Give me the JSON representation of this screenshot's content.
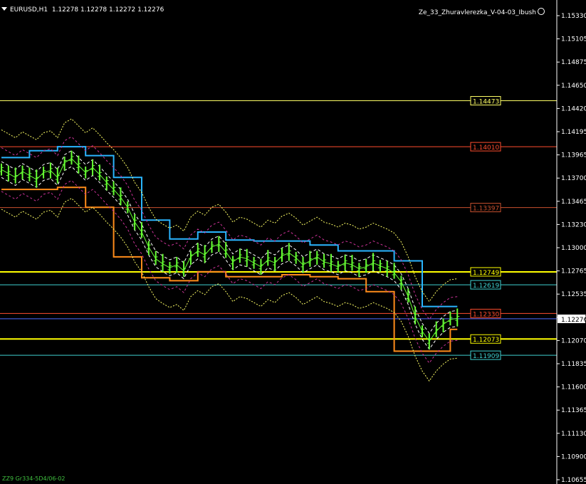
{
  "header": {
    "symbol": "EURUSD,H1",
    "ohlc": "1.12278 1.12278 1.12272 1.12276"
  },
  "indicator_name": "Ze_33_Zhuravlerezka_V-04-03_Ibush",
  "footer_text": "ZZ9 Gr334-5D4/06-02",
  "price_axis": {
    "min": 1.10655,
    "max": 1.1533,
    "ticks": [
      "1.15330",
      "1.15105",
      "1.14875",
      "1.14650",
      "1.14420",
      "1.14195",
      "1.13965",
      "1.13700",
      "1.13465",
      "1.13230",
      "1.13000",
      "1.12765",
      "1.12535",
      "1.12305",
      "1.12070",
      "1.11835",
      "1.11600",
      "1.11365",
      "1.11130",
      "1.10900",
      "1.10655"
    ]
  },
  "current_price": {
    "label": "1.12276",
    "value": 1.12276
  },
  "levels": [
    {
      "label": "1.14473",
      "value": 1.14473,
      "color": "#ffff66"
    },
    {
      "label": "1.14010",
      "value": 1.1401,
      "color": "#ff4d2e"
    },
    {
      "label": "1.13397",
      "value": 1.13397,
      "color": "#c8502e"
    },
    {
      "label": "1.12749",
      "value": 1.12749,
      "color": "#ffff00"
    },
    {
      "label": "1.12619",
      "value": 1.12619,
      "color": "#3fd0d0"
    },
    {
      "label": "1.12330",
      "value": 1.1233,
      "color": "#ff4d2e"
    },
    {
      "label": "1.12073",
      "value": 1.12073,
      "color": "#ffff00"
    },
    {
      "label": "1.11909",
      "value": 1.11909,
      "color": "#3fd0d0"
    }
  ],
  "colors": {
    "background": "#000000",
    "candle": "#66ff33",
    "channel_blue": "#2ab5ff",
    "channel_orange": "#ff8c1a",
    "band_yellow": "#ffff66",
    "band_magenta": "#cc3399",
    "band_white": "#ffffff"
  },
  "chart_data": {
    "type": "line",
    "x": [
      0,
      10,
      20,
      30,
      40,
      50,
      60,
      70,
      80,
      90,
      100,
      110,
      120,
      130,
      140,
      150,
      160,
      170,
      180,
      190,
      200,
      210,
      220,
      230,
      240,
      250,
      260,
      270,
      280,
      290,
      300,
      310,
      320,
      330,
      340,
      350,
      360,
      370,
      380,
      390,
      400,
      410,
      420,
      430,
      440,
      450,
      460,
      470,
      480,
      490,
      500,
      510,
      520,
      530,
      540,
      550,
      560,
      570,
      580,
      590,
      600,
      610,
      620,
      630,
      640,
      650
    ],
    "series": [
      {
        "values": [
          1.1378,
          1.1374,
          1.137,
          1.1376,
          1.1372,
          1.1368,
          1.1375,
          1.1377,
          1.137,
          1.1385,
          1.1389,
          1.1382,
          1.1375,
          1.138,
          1.1373,
          1.1365,
          1.1358,
          1.135,
          1.134,
          1.1325,
          1.1315,
          1.13,
          1.1288,
          1.1283,
          1.1279,
          1.1282,
          1.1276,
          1.129,
          1.1296,
          1.1292,
          1.13,
          1.1303,
          1.1295,
          1.1285,
          1.129,
          1.1288,
          1.1284,
          1.128,
          1.1287,
          1.1284,
          1.1291,
          1.1294,
          1.1289,
          1.1282,
          1.1286,
          1.129,
          1.1285,
          1.1283,
          1.128,
          1.1284,
          1.1282,
          1.1278,
          1.128,
          1.1284,
          1.1281,
          1.1278,
          1.1274,
          1.1265,
          1.125,
          1.123,
          1.1215,
          1.1205,
          1.1215,
          1.1222,
          1.1227,
          1.1228
        ]
      }
    ],
    "ylim": [
      1.10655,
      1.1533
    ]
  }
}
